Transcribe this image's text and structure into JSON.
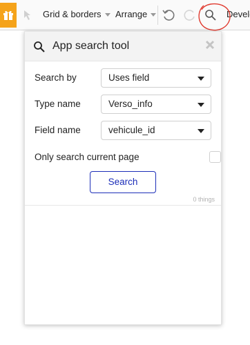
{
  "toolbar": {
    "menus": [
      {
        "label": "Grid & borders"
      },
      {
        "label": "Arrange"
      }
    ],
    "develop_label": "Develo",
    "icons": [
      "gift-icon",
      "arrow-cursor-icon",
      "undo-icon",
      "redo-icon",
      "search-icon"
    ],
    "accent_color": "#f5a31a",
    "highlight_color": "#e03a2f"
  },
  "panel": {
    "title": "App search tool",
    "fields": [
      {
        "label": "Search by",
        "value": "Uses field"
      },
      {
        "label": "Type name",
        "value": "Verso_info"
      },
      {
        "label": "Field name",
        "value": "vehicule_id"
      }
    ],
    "checkbox": {
      "label": "Only search current page",
      "checked": false
    },
    "search_button": "Search",
    "results_count": "0 things",
    "button_color": "#1b2db8"
  }
}
